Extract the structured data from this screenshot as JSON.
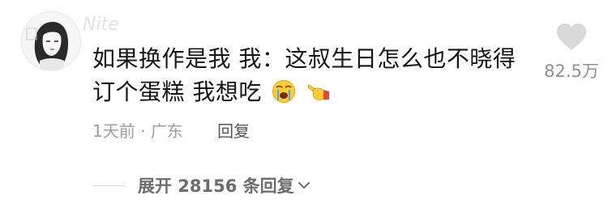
{
  "comment": {
    "username": "Nite",
    "text_line1": "如果换作是我 我：这叔生日怎么也不晓得",
    "text_line2": "订个蛋糕 我想吃",
    "emojis": [
      "crying-face-emoji",
      "pointing-hand-emoji"
    ],
    "time": "1天前",
    "separator": "·",
    "location": "广东",
    "reply_label": "回复",
    "likes": "82.5万",
    "expand_label": "展开 28156 条回复"
  },
  "colors": {
    "text": "#161616",
    "meta": "#9d9d9d",
    "heart": "#d9d9d9"
  }
}
